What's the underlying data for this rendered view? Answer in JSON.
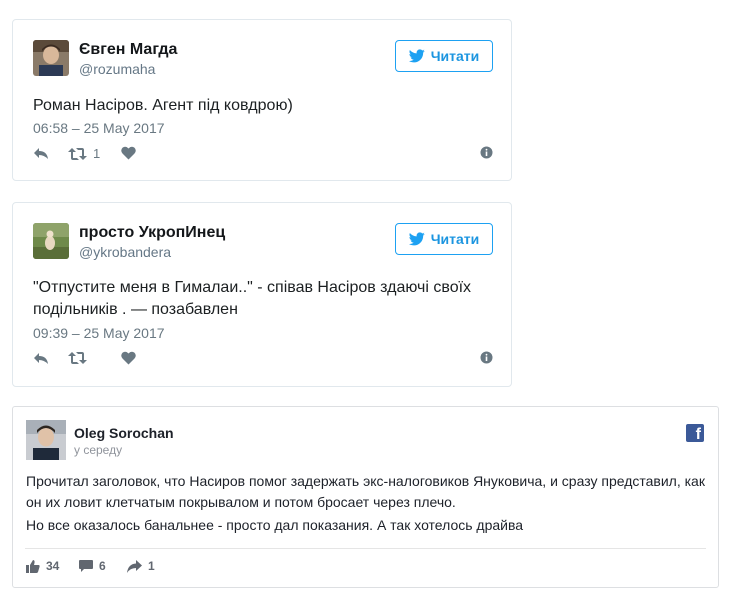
{
  "colors": {
    "twitter_blue": "#1da1f2",
    "facebook_blue": "#3b5998",
    "muted": "#697882"
  },
  "tweets": [
    {
      "name": "Євген Магда",
      "handle": "@rozumaha",
      "follow_label": "Читати",
      "text": "Роман Насіров. Агент під ковдрою)",
      "date": "06:58 – 25 May 2017",
      "retweets": "1"
    },
    {
      "name": "просто УкропИнец",
      "handle": "@ykrobandera",
      "follow_label": "Читати",
      "text": "\"Отпустите меня в Гималаи..\" - співав Насіров здаючі своїх подільників . — позабавлен",
      "date": "09:39 – 25 May 2017",
      "retweets": ""
    }
  ],
  "facebook_post": {
    "name": "Oleg Sorochan",
    "time": "у середу",
    "paragraph_1": "Прочитал заголовок, что Насиров помог задержать экс-налоговиков Януковича, и сразу представил, как он их ловит клетчатым покрывалом и потом бросает через плечо.",
    "paragraph_2": "Но все оказалось банальнее - просто дал показания. А так хотелось драйва",
    "likes": "34",
    "comments": "6",
    "shares": "1"
  }
}
